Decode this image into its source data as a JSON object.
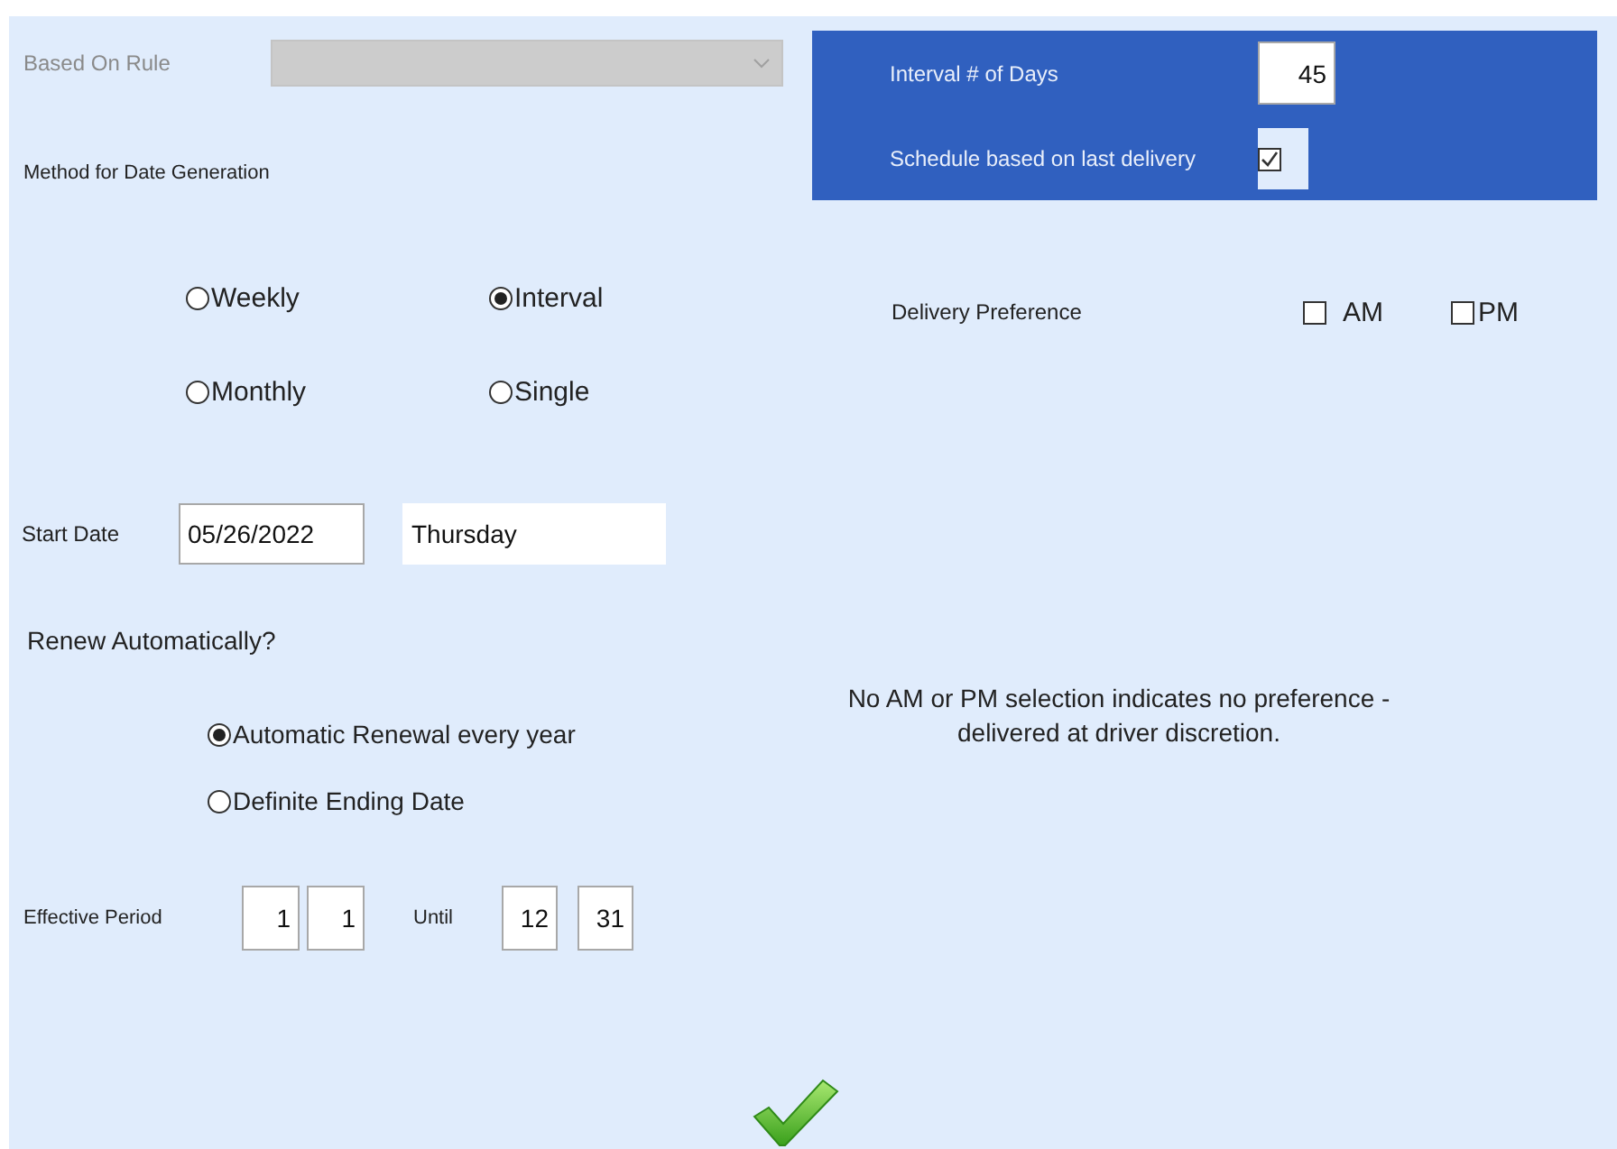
{
  "based_on_rule": {
    "label": "Based On Rule",
    "disabled": true
  },
  "method": {
    "label": "Method for Date Generation",
    "options": [
      {
        "label": "Weekly",
        "selected": false
      },
      {
        "label": "Interval",
        "selected": true
      },
      {
        "label": "Monthly",
        "selected": false
      },
      {
        "label": "Single",
        "selected": false
      }
    ]
  },
  "start_date": {
    "label": "Start Date",
    "value": "05/26/2022",
    "weekday": "Thursday"
  },
  "renew": {
    "label": "Renew Automatically?",
    "options": [
      {
        "label": "Automatic Renewal every year",
        "selected": true
      },
      {
        "label": "Definite Ending Date",
        "selected": false
      }
    ]
  },
  "effective_period": {
    "label": "Effective Period",
    "from": [
      "1",
      "1"
    ],
    "until_label": "Until",
    "until": [
      "12",
      "31"
    ]
  },
  "interval": {
    "label": "Interval # of Days",
    "value": "45"
  },
  "schedule_last_delivery": {
    "label": "Schedule based on last delivery",
    "checked": true
  },
  "delivery_preference": {
    "label": "Delivery Preference",
    "options": [
      {
        "label": "AM",
        "checked": false
      },
      {
        "label": "PM",
        "checked": false
      }
    ]
  },
  "note": "No AM or PM selection indicates no preference - delivered at driver discretion."
}
